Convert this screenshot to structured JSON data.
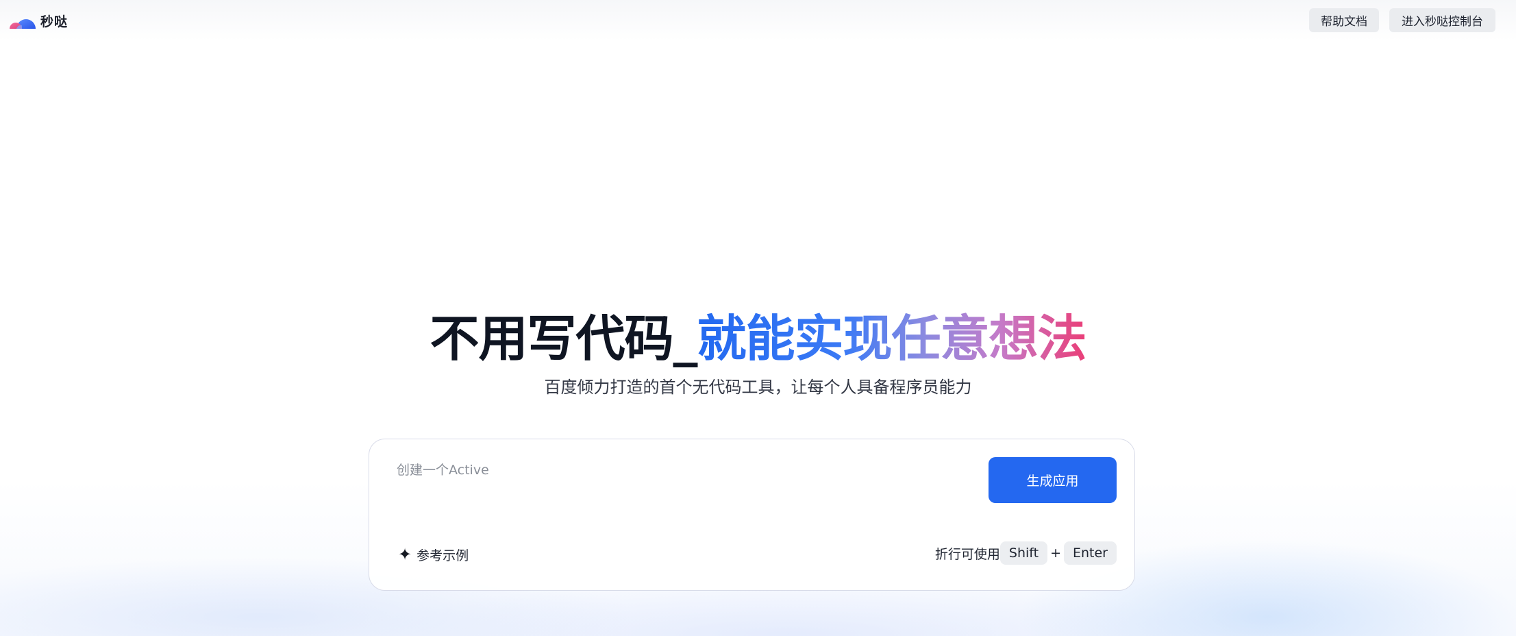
{
  "header": {
    "logo_text": "秒哒",
    "help_label": "帮助文档",
    "console_label": "进入秒哒控制台"
  },
  "hero": {
    "title_dark": "不用写代码_",
    "title_gradient": "就能实现任意想法",
    "subtitle": "百度倾力打造的首个无代码工具，让每个人具备程序员能力"
  },
  "prompt": {
    "placeholder": "创建一个Active",
    "generate_label": "生成应用",
    "examples_label": "参考示例",
    "hint_prefix": "折行可使用",
    "key_shift": "Shift",
    "key_plus": "+",
    "key_enter": "Enter"
  },
  "colors": {
    "primary": "#2468f0",
    "gradient_start": "#2369f0",
    "gradient_end": "#ea3e77"
  },
  "icons": {
    "logo": "cloud-logo-icon",
    "examples": "sparkle-icon"
  }
}
